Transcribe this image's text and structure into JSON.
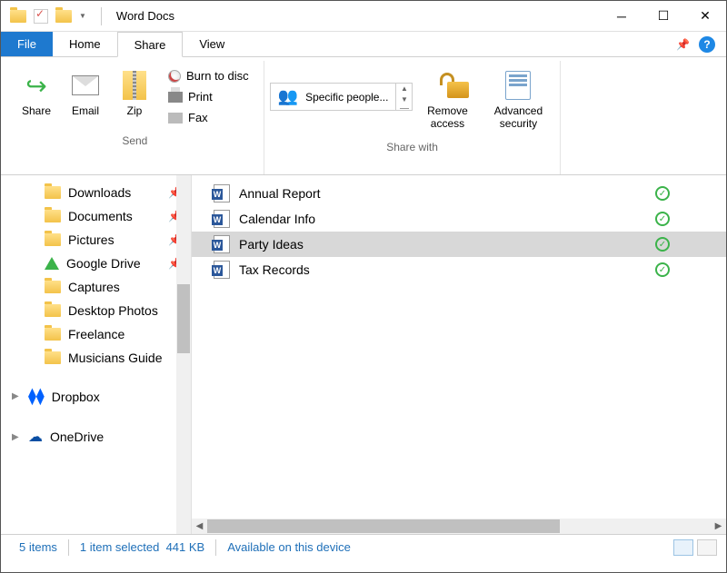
{
  "window": {
    "title": "Word Docs"
  },
  "tabs": {
    "file": "File",
    "home": "Home",
    "share": "Share",
    "view": "View"
  },
  "ribbon": {
    "send": {
      "label": "Send",
      "share": "Share",
      "email": "Email",
      "zip": "Zip",
      "burn": "Burn to disc",
      "print": "Print",
      "fax": "Fax"
    },
    "sharewith": {
      "label": "Share with",
      "specific": "Specific people...",
      "remove": "Remove access",
      "advanced": "Advanced security"
    }
  },
  "sidebar": {
    "items": [
      {
        "label": "Downloads",
        "pinned": true,
        "icon": "folder"
      },
      {
        "label": "Documents",
        "pinned": true,
        "icon": "folder"
      },
      {
        "label": "Pictures",
        "pinned": true,
        "icon": "folder"
      },
      {
        "label": "Google Drive",
        "pinned": true,
        "icon": "gdrive"
      },
      {
        "label": "Captures",
        "pinned": false,
        "icon": "folder"
      },
      {
        "label": "Desktop Photos",
        "pinned": false,
        "icon": "folder"
      },
      {
        "label": "Freelance",
        "pinned": false,
        "icon": "folder"
      },
      {
        "label": "Musicians Guide",
        "pinned": false,
        "icon": "folder"
      }
    ],
    "roots": [
      {
        "label": "Dropbox",
        "icon": "dropbox"
      },
      {
        "label": "OneDrive",
        "icon": "onedrive"
      }
    ]
  },
  "files": [
    {
      "name": "Annual Report",
      "synced": true,
      "selected": false
    },
    {
      "name": "Calendar Info",
      "synced": true,
      "selected": false
    },
    {
      "name": "Party Ideas",
      "synced": true,
      "selected": true
    },
    {
      "name": "Tax Records",
      "synced": true,
      "selected": false
    }
  ],
  "status": {
    "count": "5 items",
    "selected": "1 item selected",
    "size": "441 KB",
    "availability": "Available on this device"
  }
}
